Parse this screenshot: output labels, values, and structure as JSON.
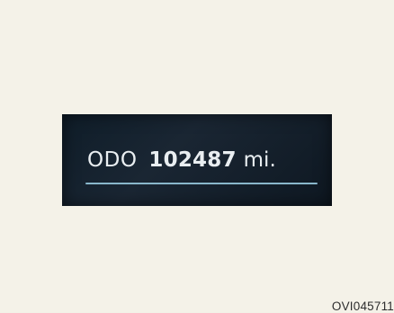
{
  "panel": {
    "label": "ODO",
    "value": "102487",
    "unit": "mi."
  },
  "caption": {
    "code": "OVI045711"
  },
  "colors": {
    "background": "#f4f2e8",
    "display_background": "#13212e",
    "display_text": "#e9eef1",
    "underline": "#89b7cb"
  }
}
